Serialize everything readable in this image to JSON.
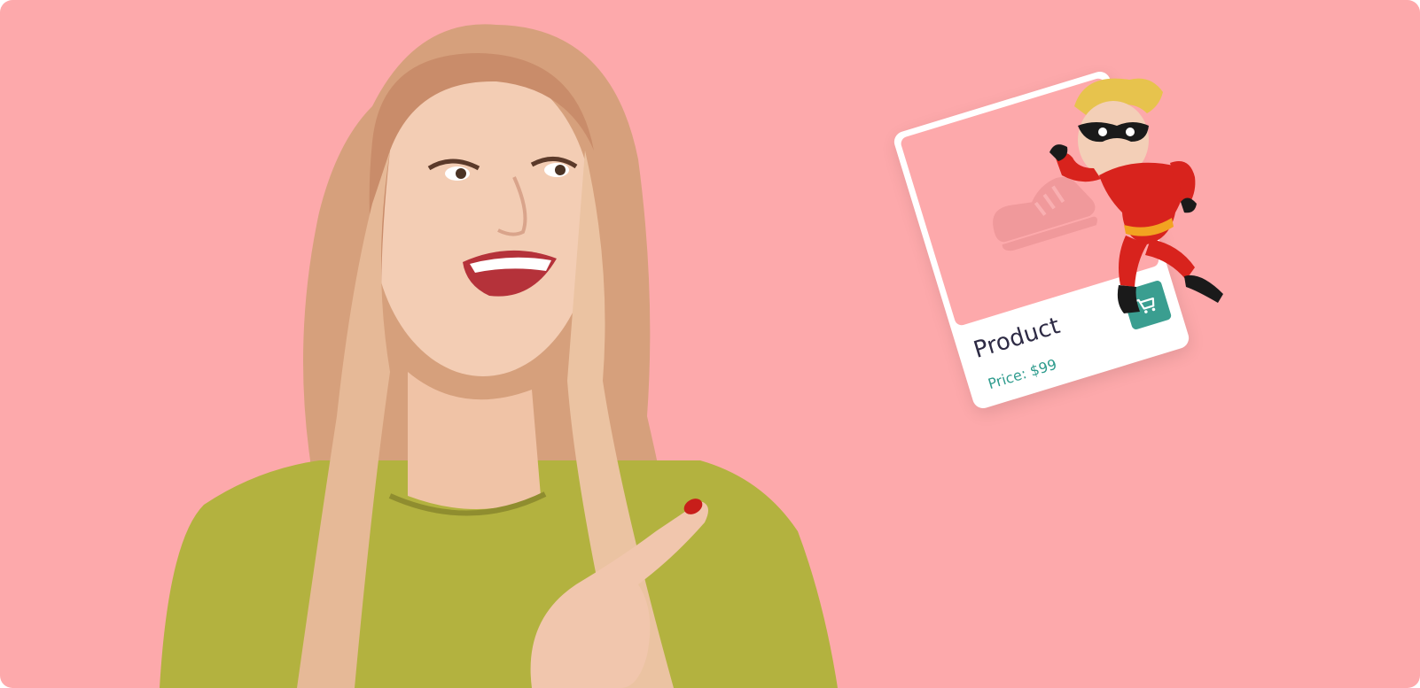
{
  "colors": {
    "background": "#fda9ab",
    "card": "#ffffff",
    "accent": "#3a9e90",
    "price": "#2f9c8e",
    "title": "#2d2a44",
    "shirt": "#b3b23f",
    "hair": "#d9a27e",
    "hero_suit": "#d8231d",
    "hero_hair": "#e7c34d"
  },
  "card": {
    "title": "Product",
    "price": "Price: $99",
    "image_icon": "shoe-icon",
    "cart_icon": "shopping-cart-icon"
  },
  "illustrations": {
    "person": "smiling woman pointing",
    "mascot": "superhero-mascot"
  }
}
